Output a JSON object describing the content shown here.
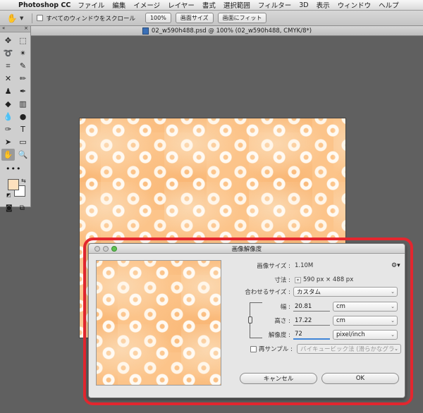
{
  "menubar": {
    "apple_glyph": "",
    "app_name": "Photoshop CC",
    "items": [
      "ファイル",
      "編集",
      "イメージ",
      "レイヤー",
      "書式",
      "選択範囲",
      "フィルター",
      "3D",
      "表示",
      "ウィンドウ",
      "ヘルプ"
    ]
  },
  "options": {
    "scroll_all_label": "すべてのウィンドウをスクロール",
    "zoom_100": "100%",
    "screen_fit": "画面サイズ",
    "fill_screen": "画面にフィット"
  },
  "document": {
    "tab_title": "02_w590h488.psd @ 100% (02_w590h488, CMYK/8*)"
  },
  "tools": {
    "collapse_glyph": "«",
    "close_glyph": "×",
    "items": [
      {
        "name": "move-icon",
        "glyph": "✥"
      },
      {
        "name": "marquee-icon",
        "glyph": "⬚"
      },
      {
        "name": "lasso-icon",
        "glyph": "➰"
      },
      {
        "name": "magic-wand-icon",
        "glyph": "✴"
      },
      {
        "name": "crop-icon",
        "glyph": "⌗"
      },
      {
        "name": "eyedropper-icon",
        "glyph": "✎"
      },
      {
        "name": "healing-brush-icon",
        "glyph": "✕"
      },
      {
        "name": "brush-icon",
        "glyph": "✏"
      },
      {
        "name": "stamp-icon",
        "glyph": "♟"
      },
      {
        "name": "history-brush-icon",
        "glyph": "✒"
      },
      {
        "name": "eraser-icon",
        "glyph": "◆"
      },
      {
        "name": "gradient-icon",
        "glyph": "▥"
      },
      {
        "name": "blur-icon",
        "glyph": "💧"
      },
      {
        "name": "dodge-icon",
        "glyph": "●"
      },
      {
        "name": "pen-icon",
        "glyph": "✑"
      },
      {
        "name": "type-icon",
        "glyph": "T"
      },
      {
        "name": "path-select-icon",
        "glyph": "➤"
      },
      {
        "name": "shape-icon",
        "glyph": "▭"
      },
      {
        "name": "hand-icon",
        "glyph": "✋"
      },
      {
        "name": "zoom-icon",
        "glyph": "🔍"
      }
    ],
    "more_glyph": "•••",
    "swap_glyph": "⇆",
    "default_glyph": "◩",
    "quick_mask_glyph": "◙",
    "screen_mode_glyph": "⧉",
    "foreground_color": "#fde0bd",
    "background_color": "#ffffff"
  },
  "dialog": {
    "title": "画像解像度",
    "image_size_label": "画像サイズ :",
    "image_size_value": "1.10M",
    "dimensions_label": "寸法 :",
    "dimensions_value": "590 px × 488 px",
    "fit_to_label": "合わせるサイズ :",
    "fit_to_value": "カスタム",
    "width_label": "幅 :",
    "width_value": "20.81",
    "width_unit": "cm",
    "height_label": "高さ :",
    "height_value": "17.22",
    "height_unit": "cm",
    "resolution_label": "解像度 :",
    "resolution_value": "72",
    "resolution_unit": "pixel/inch",
    "resample_label": "再サンプル :",
    "resample_value": "バイキュービック法 (滑らかなグラデー...",
    "cancel_label": "キャンセル",
    "ok_label": "OK"
  },
  "colors": {
    "highlight": "#e4272f",
    "pattern_base": "#fcc48a"
  }
}
